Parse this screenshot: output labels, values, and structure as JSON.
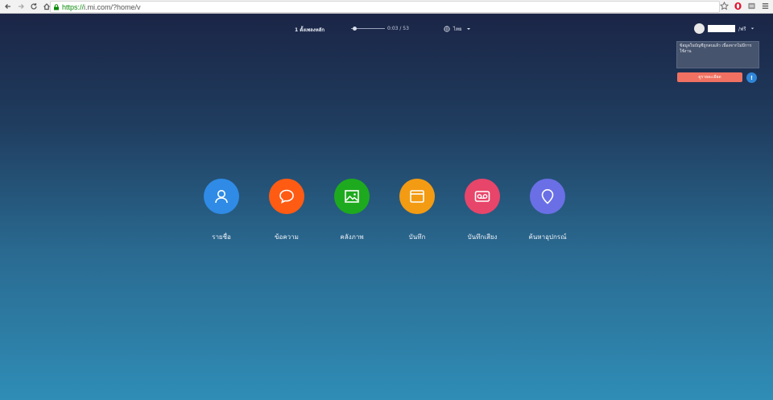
{
  "browser": {
    "url_scheme": "https://",
    "url_rest": "i.mi.com/?home/v",
    "icons": [
      "back-icon",
      "forward-icon",
      "reload-icon",
      "home-icon",
      "lock-icon",
      "star-icon",
      "opera-icon",
      "extension-icon",
      "menu-icon"
    ]
  },
  "player": {
    "song_title": "1 ตั้งเพลงหลัก",
    "time": "0:03 / 53",
    "progress_fraction": 0.05,
    "language": "ไทย"
  },
  "user": {
    "name_suffix": "/ฟรี"
  },
  "notice": {
    "text": "ข้อมูลในบัญชีถูกลบแล้ว เนื่องจากไม่มีการใช้งาน",
    "button_label": "ดูรายละเอียด",
    "info_icon_label": "!"
  },
  "features": [
    {
      "label": "รายชื่อ",
      "color": "#2f8be6",
      "icon": "contact-icon"
    },
    {
      "label": "ข้อความ",
      "color": "#ff5b13",
      "icon": "message-icon"
    },
    {
      "label": "คลังภาพ",
      "color": "#1eaa1e",
      "icon": "gallery-icon"
    },
    {
      "label": "บันทึก",
      "color": "#f39b12",
      "icon": "note-icon"
    },
    {
      "label": "บันทึกเสียง",
      "color": "#e8456a",
      "icon": "recorder-icon"
    },
    {
      "label": "ค้นหาอุปกรณ์",
      "color": "#6a6fe6",
      "icon": "find-device-icon"
    }
  ]
}
